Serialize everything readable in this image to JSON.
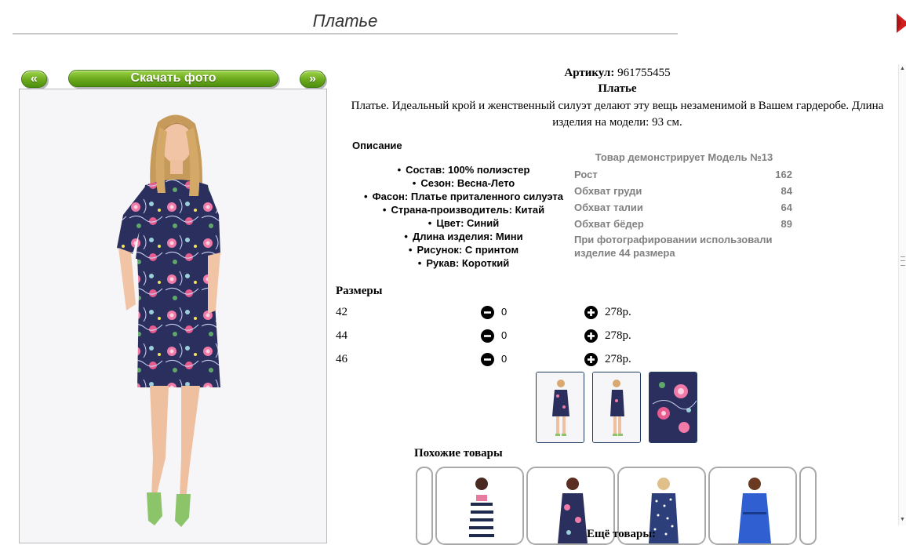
{
  "header": {
    "title": "Платье"
  },
  "gallery": {
    "prev_label": "«",
    "download_label": "Скачать фото",
    "next_label": "»"
  },
  "product": {
    "sku_label": "Артикул:",
    "sku_value": "961755455",
    "name": "Платье",
    "description": "Платье. Идеальный крой и женственный силуэт делают эту вещь незаменимой в Вашем гардеробе. Длина изделия на модели: 93 см.",
    "details_heading": "Описание",
    "attributes": [
      "Состав: 100% полиэстер",
      "Сезон: Весна-Лето",
      "Фасон: Платье приталенного силуэта",
      "Страна-производитель: Китай",
      "Цвет: Синий",
      "Длина изделия: Мини",
      "Рисунок: С принтом",
      "Рукав: Короткий"
    ]
  },
  "model": {
    "title": "Товар демонстрирует Модель №13",
    "rows": [
      {
        "label": "Рост",
        "value": "162"
      },
      {
        "label": "Обхват груди",
        "value": "84"
      },
      {
        "label": "Обхват талии",
        "value": "64"
      },
      {
        "label": "Обхват бёдер",
        "value": "89"
      }
    ],
    "note": "При фотографировании использовали изделие 44 размера"
  },
  "sizes": {
    "heading": "Размеры",
    "rows": [
      {
        "size": "42",
        "qty": "0",
        "price": "278р."
      },
      {
        "size": "44",
        "qty": "0",
        "price": "278р."
      },
      {
        "size": "46",
        "qty": "0",
        "price": "278р."
      }
    ]
  },
  "similar": {
    "heading": "Похожие товары"
  },
  "more": {
    "heading": "Ещё товары:"
  },
  "colors": {
    "accent_green": "#6aa81c",
    "close_red": "#d11f1f",
    "dress_navy": "#2a2f5e",
    "thumb_border": "#1f3b5e"
  },
  "icons": {
    "close": "close-icon",
    "minus": "minus-circle-icon",
    "plus": "plus-circle-icon"
  }
}
